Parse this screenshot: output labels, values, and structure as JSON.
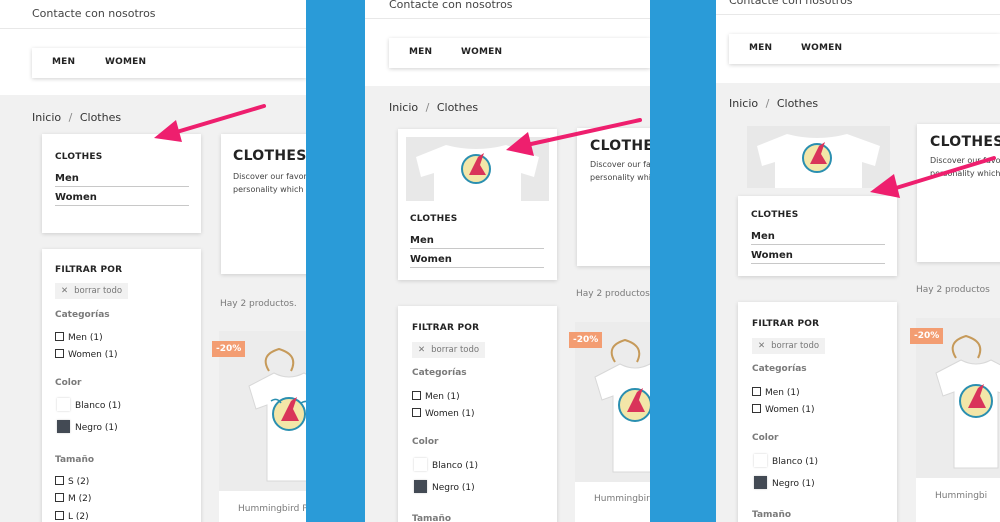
{
  "header": {
    "contact_label": "Contacte con nosotros"
  },
  "nav": {
    "items": [
      {
        "label": "MEN"
      },
      {
        "label": "WOMEN"
      }
    ]
  },
  "breadcrumb": {
    "home": "Inicio",
    "separator": "/",
    "current": "Clothes"
  },
  "sidebar": {
    "block_title": "CLOTHES",
    "categories": [
      {
        "label": "Men"
      },
      {
        "label": "Women"
      }
    ]
  },
  "category": {
    "title": "CLOTHES",
    "description_line1": "Discover our favorites fashionable discoveries, a selection of cool items to integrate in your wardrobe. Compose a unique style with",
    "description_line2": "personality which matches your own."
  },
  "filters": {
    "title": "FILTRAR POR",
    "clear_label": "borrar todo",
    "categories_heading": "Categorías",
    "category_options": [
      {
        "label": "Men (1)"
      },
      {
        "label": "Women (1)"
      }
    ],
    "color_heading": "Color",
    "color_options": [
      {
        "label": "Blanco (1)",
        "color": "#ffffff"
      },
      {
        "label": "Negro (1)",
        "color": "#434a54"
      }
    ],
    "size_heading": "Tamaño",
    "size_options": [
      {
        "label": "S (2)"
      },
      {
        "label": "M (2)"
      },
      {
        "label": "L (2)"
      }
    ]
  },
  "products": {
    "count_text": "Hay 2 productos.",
    "count_text_short": "Hay 2 productos",
    "items": [
      {
        "name": "Hummingbird P",
        "discount": "-20%"
      }
    ],
    "name_panel2": "Hummingbird",
    "name_panel3": "Hummingbi"
  },
  "colors": {
    "accent_arrow": "#ee1f6e",
    "divider_blue": "#2a9bd8",
    "badge": "#f39d72"
  }
}
